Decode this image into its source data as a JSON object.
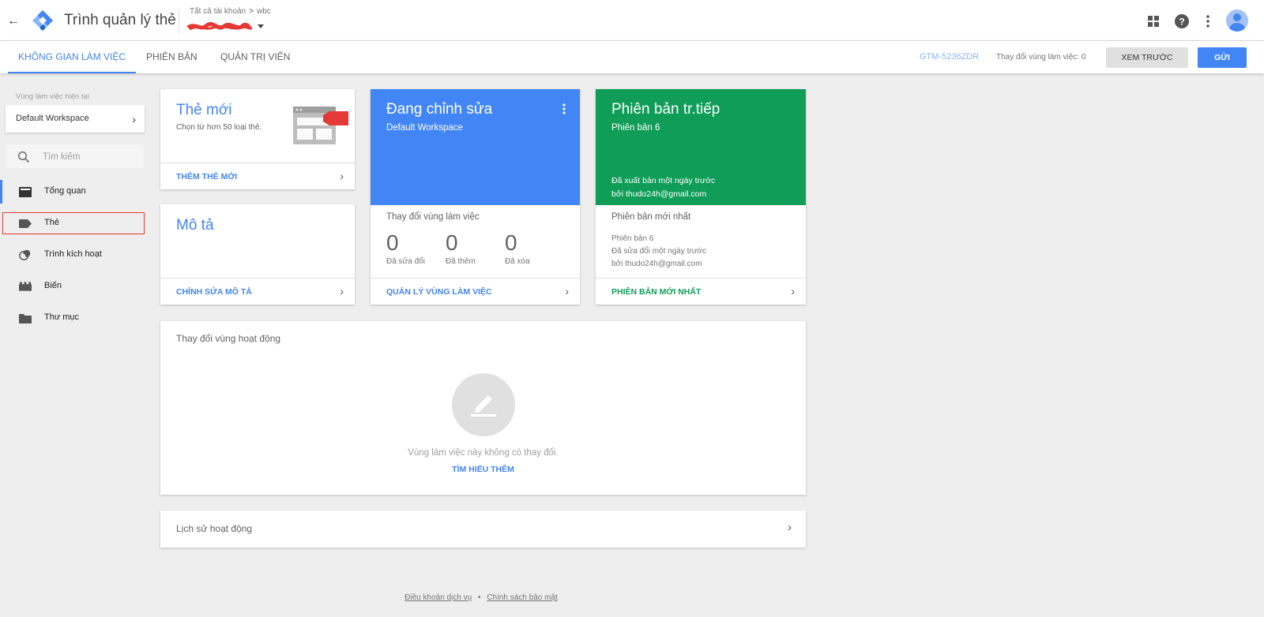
{
  "header": {
    "app_title": "Trình quản lý thẻ",
    "breadcrumb": {
      "all_accounts": "Tất cả tài khoản",
      "separator": ">",
      "account": "wbc"
    },
    "icons": [
      "back-arrow-icon",
      "apps-grid-icon",
      "help-icon",
      "more-vert-icon",
      "account-avatar-icon"
    ]
  },
  "tabs": [
    {
      "label": "KHÔNG GIAN LÀM VIỆC",
      "active": true
    },
    {
      "label": "PHIÊN BẢN",
      "active": false
    },
    {
      "label": "QUẢN TRỊ VIÊN",
      "active": false
    }
  ],
  "navbar_right": {
    "container_id": "GTM-5236ZDR",
    "workspace_changes": "Thay đổi vùng làm việc: 0",
    "preview_label": "XEM TRƯỚC",
    "submit_label": "GỬI"
  },
  "sidebar": {
    "current_workspace_label": "Vùng làm việc hiện tại",
    "workspace_name": "Default Workspace",
    "search_placeholder": "Tìm kiếm",
    "items": [
      {
        "label": "Tổng quan",
        "icon": "overview-icon",
        "active": true
      },
      {
        "label": "Thẻ",
        "icon": "tag-icon",
        "active": false,
        "highlighted": true
      },
      {
        "label": "Trình kích hoạt",
        "icon": "trigger-icon",
        "active": false
      },
      {
        "label": "Biến",
        "icon": "variable-icon",
        "active": false
      },
      {
        "label": "Thư mục",
        "icon": "folder-icon",
        "active": false
      }
    ]
  },
  "cards": {
    "new_tag": {
      "title": "Thẻ mới",
      "subtitle": "Chọn từ hơn 50 loại thẻ.",
      "action": "THÊM THẺ MỚI"
    },
    "description": {
      "title": "Mô tả",
      "action": "CHỈNH SỬA MÔ TẢ"
    },
    "editing": {
      "title": "Đang chỉnh sửa",
      "workspace": "Default Workspace",
      "section_label": "Thay đổi vùng làm việc",
      "stats": [
        {
          "value": "0",
          "label": "Đã sửa đổi"
        },
        {
          "value": "0",
          "label": "Đã thêm"
        },
        {
          "value": "0",
          "label": "Đã xóa"
        }
      ],
      "action": "QUẢN LÝ VÙNG LÀM VIỆC",
      "color": "#4285f4"
    },
    "live_version": {
      "title": "Phiên bản tr.tiếp",
      "version": "Phiên bản 6",
      "published": "Đã xuất bản một ngày trước",
      "published_by": "bởi thudo24h@gmail.com",
      "latest_label": "Phiên bản mới nhất",
      "latest_version": "Phiên bản 6",
      "latest_modified": "Đã sửa đổi một ngày trước",
      "latest_by": "bởi thudo24h@gmail.com",
      "action": "PHIÊN BẢN MỚI NHẤT",
      "color": "#0f9d58"
    },
    "workspace_changes": {
      "title": "Thay đổi vùng hoạt động",
      "empty_text": "Vùng làm việc này không có thay đổi.",
      "learn_more": "TÌM HIỂU THÊM"
    },
    "activity_history": {
      "title": "Lịch sử hoạt động"
    }
  },
  "footer": {
    "terms": "Điều khoản dịch vụ",
    "dot": "•",
    "privacy": "Chính sách bảo mật"
  }
}
